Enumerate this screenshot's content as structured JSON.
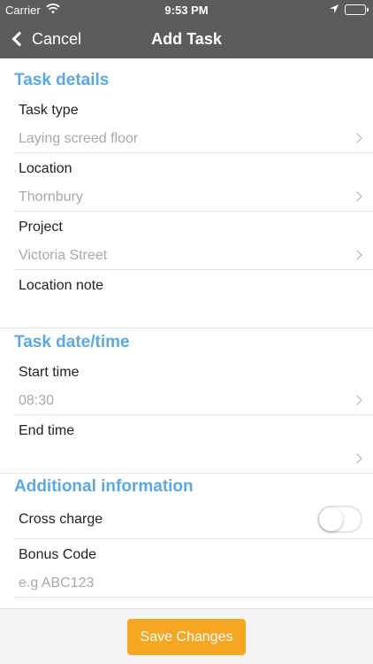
{
  "status": {
    "carrier": "Carrier",
    "time": "9:53 PM"
  },
  "nav": {
    "back_label": "Cancel",
    "title": "Add Task"
  },
  "sections": {
    "task_details": "Task details",
    "task_datetime": "Task date/time",
    "additional_info": "Additional information"
  },
  "fields": {
    "task_type": {
      "label": "Task type",
      "value": "Laying screed floor"
    },
    "location": {
      "label": "Location",
      "value": "Thornbury"
    },
    "project": {
      "label": "Project",
      "value": "Victoria Street"
    },
    "location_note": {
      "label": "Location note",
      "value": ""
    },
    "start_time": {
      "label": "Start time",
      "value": "08:30"
    },
    "end_time": {
      "label": "End time",
      "value": ""
    },
    "cross_charge": {
      "label": "Cross charge",
      "enabled": false
    },
    "bonus_code": {
      "label": "Bonus Code",
      "placeholder": "e.g ABC123"
    }
  },
  "footer": {
    "save_label": "Save Changes"
  },
  "colors": {
    "nav_bg": "#5c5c5c",
    "section_title": "#5aa9e6",
    "save_button": "#f5a623"
  }
}
